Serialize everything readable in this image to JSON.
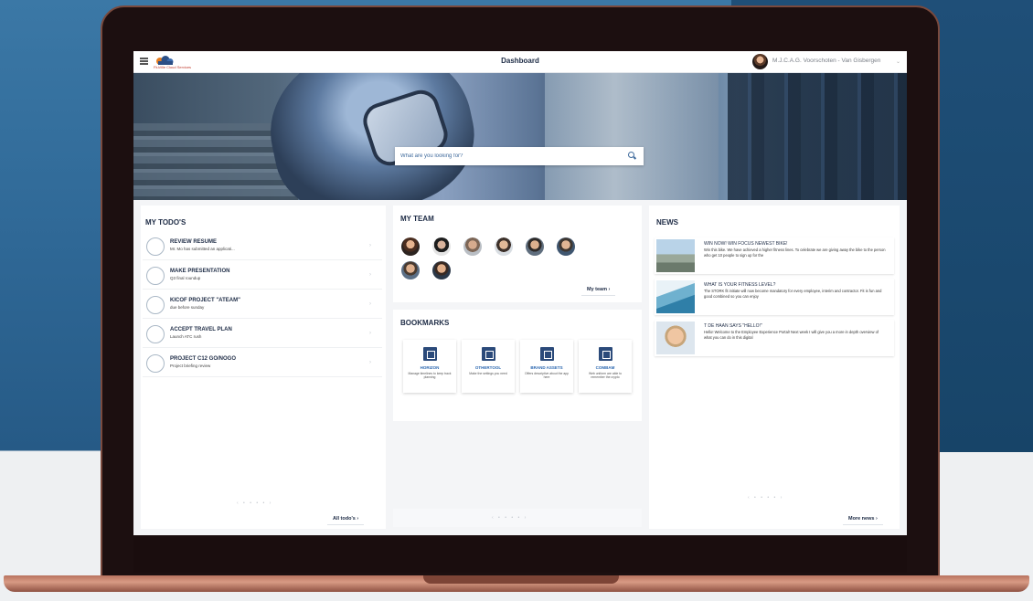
{
  "header": {
    "logo_text": "FluVille Cloud Services",
    "title": "Dashboard",
    "user_name": "M.J.C.A.G. Voorschoten - Van Gisbergen"
  },
  "search": {
    "placeholder": "What are you looking for?"
  },
  "todos": {
    "title": "MY TODO'S",
    "items": [
      {
        "title": "REVIEW RESUME",
        "subtitle": "Mr. Mo has submitted an applicati..."
      },
      {
        "title": "MAKE PRESENTATION",
        "subtitle": "Q3 final roundup"
      },
      {
        "title": "KICOF PROJECT \"ATEAM\"",
        "subtitle": "due before sunday"
      },
      {
        "title": "ACCEPT TRAVEL PLAN",
        "subtitle": "Launch ATC rush"
      },
      {
        "title": "PROJECT C12 GO/NOGO",
        "subtitle": "Project briefing review"
      }
    ],
    "pager": "‹ • • • • ›",
    "footer_link": "All todo's"
  },
  "team": {
    "title": "MY TEAM",
    "footer_link": "My team"
  },
  "bookmarks": {
    "title": "BOOKMARKS",
    "items": [
      {
        "name": "HORIZON",
        "desc": "Manage timelines to keep track planning"
      },
      {
        "name": "OTHERTOOL",
        "desc": "Make the settings you need"
      },
      {
        "name": "BRAND ASSETS",
        "desc": "Offers descriptive about the app here"
      },
      {
        "name": "COMBAM",
        "desc": "Web uniform are able to remember the crypto"
      }
    ],
    "pager": "‹ • • • • ›"
  },
  "news": {
    "title": "NEWS",
    "items": [
      {
        "title": "WIN NOW! WIN FOCUS NEWEST BIKE!",
        "body": "Win this bike. We have achieved a higher fitness lines. To celebrate we are giving away the bike to the person who get 10 people to sign up for the"
      },
      {
        "title": "WHAT IS YOUR FITNESS LEVEL?",
        "body": "The STORK fit initiate will now become mandatory for every employee, interim and contractor. Fit is fun and good combined so you can enjoy"
      },
      {
        "title": "T DE HAAN SAYS \"HELLO!\"",
        "body": "Hello! Welcome to the Employee Experience Portal! Next week I will give you a more in depth overview of what you can do in this digital"
      }
    ],
    "pager": "‹ • • • • ›",
    "footer_link": "More news"
  },
  "colors": {
    "primary": "#1d2b45",
    "link": "#2b67b0",
    "accent_red": "#c0392b",
    "bookmark_icon": "#2b4a7a"
  }
}
